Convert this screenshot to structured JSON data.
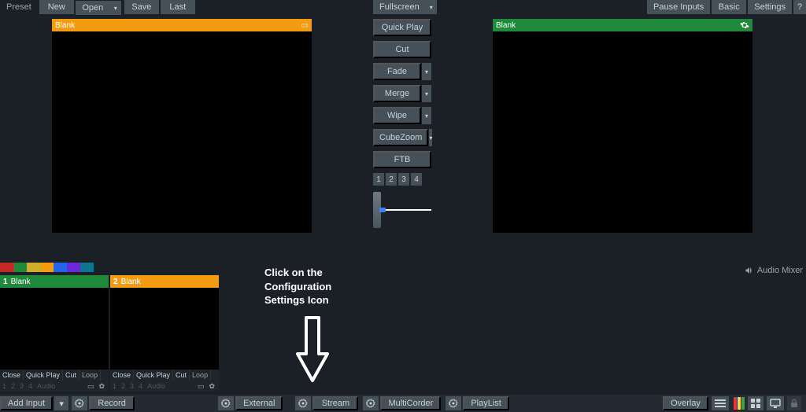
{
  "topbar": {
    "preset_label": "Preset",
    "new": "New",
    "open": "Open",
    "save": "Save",
    "last": "Last",
    "fullscreen": "Fullscreen",
    "pause_inputs": "Pause Inputs",
    "basic": "Basic",
    "settings": "Settings",
    "help": "?"
  },
  "preview": {
    "title": "Blank"
  },
  "program": {
    "title": "Blank"
  },
  "transitions": {
    "quick_play": "Quick Play",
    "cut": "Cut",
    "fade": "Fade",
    "merge": "Merge",
    "wipe": "Wipe",
    "cubezoom": "CubeZoom",
    "ftb": "FTB",
    "nums": [
      "1",
      "2",
      "3",
      "4"
    ]
  },
  "swatch_colors": [
    "#c62828",
    "#1f8a3b",
    "#cfae2e",
    "#f39c12",
    "#2563eb",
    "#6d28d9",
    "#0e7490"
  ],
  "audio_mixer_label": "Audio Mixer",
  "inputs": [
    {
      "num": "1",
      "name": "Blank",
      "controls": [
        "Close",
        "Quick Play",
        "Cut",
        "Loop"
      ],
      "controls2": [
        "1",
        "2",
        "3",
        "4",
        "Audio"
      ]
    },
    {
      "num": "2",
      "name": "Blank",
      "controls": [
        "Close",
        "Quick Play",
        "Cut",
        "Loop"
      ],
      "controls2": [
        "1",
        "2",
        "3",
        "4",
        "Audio"
      ]
    }
  ],
  "instruction": {
    "line1": "Click on the",
    "line2": "Configuration",
    "line3": "Settings Icon"
  },
  "bottombar": {
    "add_input": "Add Input",
    "record": "Record",
    "external": "External",
    "stream": "Stream",
    "multicorder": "MultiCorder",
    "playlist": "PlayList",
    "overlay": "Overlay"
  }
}
